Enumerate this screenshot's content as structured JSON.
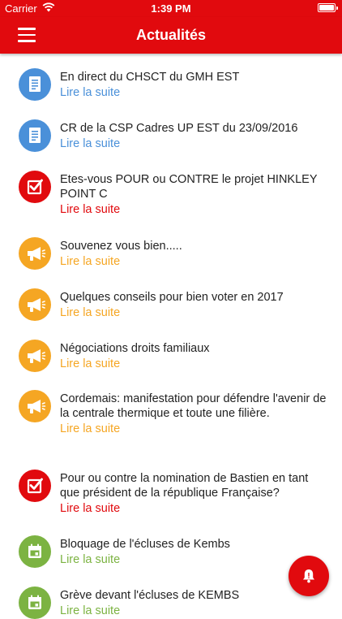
{
  "status_bar": {
    "carrier": "Carrier",
    "time": "1:39 PM",
    "battery_level": 1.0
  },
  "header": {
    "title": "Actualités"
  },
  "colors": {
    "brand_red": "#e10a0e",
    "blue": "#4a90d9",
    "red": "#e10a0e",
    "orange": "#f5a623",
    "green": "#7cb342"
  },
  "news": [
    {
      "title": "En direct du CHSCT du GMH EST",
      "link": "Lire la suite",
      "icon": "document-icon",
      "color": "blue"
    },
    {
      "title": "CR de la CSP Cadres UP EST du 23/09/2016",
      "link": "Lire la suite",
      "icon": "document-icon",
      "color": "blue"
    },
    {
      "title": "Etes-vous POUR ou CONTRE le projet HINKLEY POINT C",
      "link": "Lire la suite",
      "icon": "vote-checkbox-icon",
      "color": "red"
    },
    {
      "title": "Souvenez vous bien.....",
      "link": "Lire la suite",
      "icon": "megaphone-icon",
      "color": "orange"
    },
    {
      "title": "Quelques conseils pour bien voter en 2017",
      "link": "Lire la suite",
      "icon": "megaphone-icon",
      "color": "orange"
    },
    {
      "title": "Négociations droits familiaux",
      "link": "Lire la suite",
      "icon": "megaphone-icon",
      "color": "orange"
    },
    {
      "title": "Cordemais: manifestation pour défendre l'avenir de la centrale thermique et toute une filière.",
      "link": "Lire la suite",
      "icon": "megaphone-icon",
      "color": "orange"
    },
    {
      "title": "Pour ou contre la nomination de Bastien en tant que président de la république Française?",
      "link": "Lire la suite",
      "icon": "vote-checkbox-icon",
      "color": "red"
    },
    {
      "title": "Bloquage de l'écluses de Kembs",
      "link": "Lire la suite",
      "icon": "calendar-icon",
      "color": "green"
    },
    {
      "title": "Grève devant l'écluses de KEMBS",
      "link": "Lire la suite",
      "icon": "calendar-icon",
      "color": "green"
    }
  ],
  "fab": {
    "icon": "bell-alert-icon"
  }
}
